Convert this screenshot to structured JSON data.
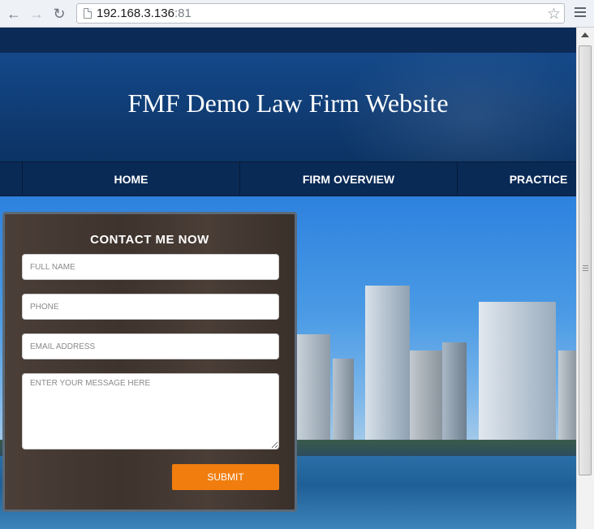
{
  "browser": {
    "url_host": "192.168.3.136",
    "url_port": ":81"
  },
  "site": {
    "title": "FMF Demo Law Firm Website",
    "nav": [
      "HOME",
      "FIRM OVERVIEW",
      "PRACTICE"
    ]
  },
  "contact_form": {
    "title": "CONTACT ME NOW",
    "full_name_placeholder": "FULL NAME",
    "phone_placeholder": "PHONE",
    "email_placeholder": "EMAIL ADDRESS",
    "message_placeholder": "ENTER YOUR MESSAGE HERE",
    "submit_label": "SUBMIT"
  },
  "colors": {
    "header_blue": "#0f3b72",
    "nav_blue": "#0a2a56",
    "submit_orange": "#f07d0d"
  }
}
